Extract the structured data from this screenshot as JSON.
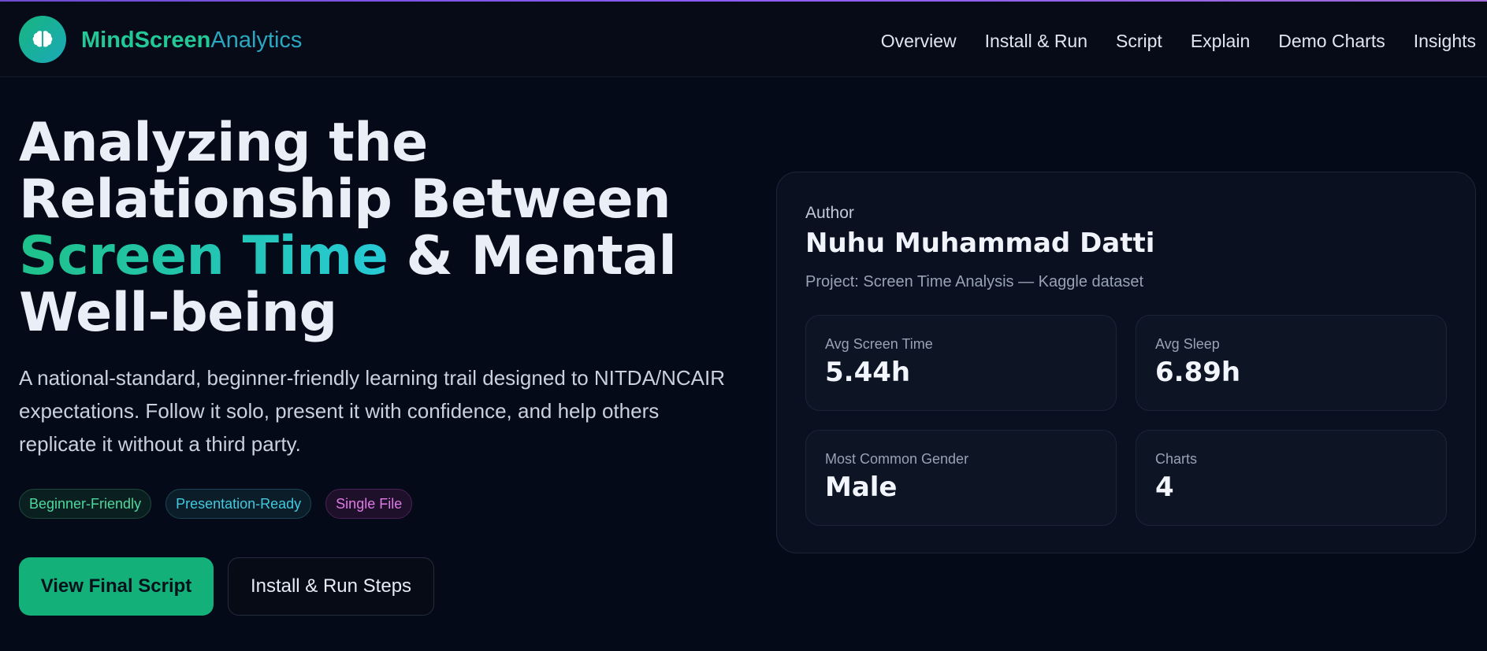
{
  "brand": {
    "name_bold": "MindScreen",
    "name_light": "Analytics",
    "logo_icon": "brain-icon"
  },
  "nav": {
    "items": [
      "Overview",
      "Install & Run",
      "Script",
      "Explain",
      "Demo Charts",
      "Insights"
    ]
  },
  "hero": {
    "title_line1": "Analyzing the",
    "title_line2": "Relationship Between",
    "title_highlight": "Screen Time",
    "title_line3_rest": " & Mental",
    "title_line4": "Well-being",
    "description": "A national-standard, beginner-friendly learning trail designed to NITDA/NCAIR expectations. Follow it solo, present it with confidence, and help others replicate it without a third party.",
    "tags": [
      {
        "label": "Beginner-Friendly",
        "color": "#4fd89e"
      },
      {
        "label": "Presentation-Ready",
        "color": "#43c9df"
      },
      {
        "label": "Single File",
        "color": "#e279e8"
      }
    ],
    "primary_button": "View Final Script",
    "secondary_button": "Install & Run Steps"
  },
  "card": {
    "author_label": "Author",
    "author_name": "Nuhu Muhammad Datti",
    "project": "Project: Screen Time Analysis — Kaggle dataset",
    "stats": [
      {
        "label": "Avg Screen Time",
        "value": "5.44h"
      },
      {
        "label": "Avg Sleep",
        "value": "6.89h"
      },
      {
        "label": "Most Common Gender",
        "value": "Male"
      },
      {
        "label": "Charts",
        "value": "4"
      }
    ]
  },
  "colors": {
    "background": "#050a18",
    "accent_green": "#13b07a",
    "accent_cyan": "#27c9d6"
  }
}
